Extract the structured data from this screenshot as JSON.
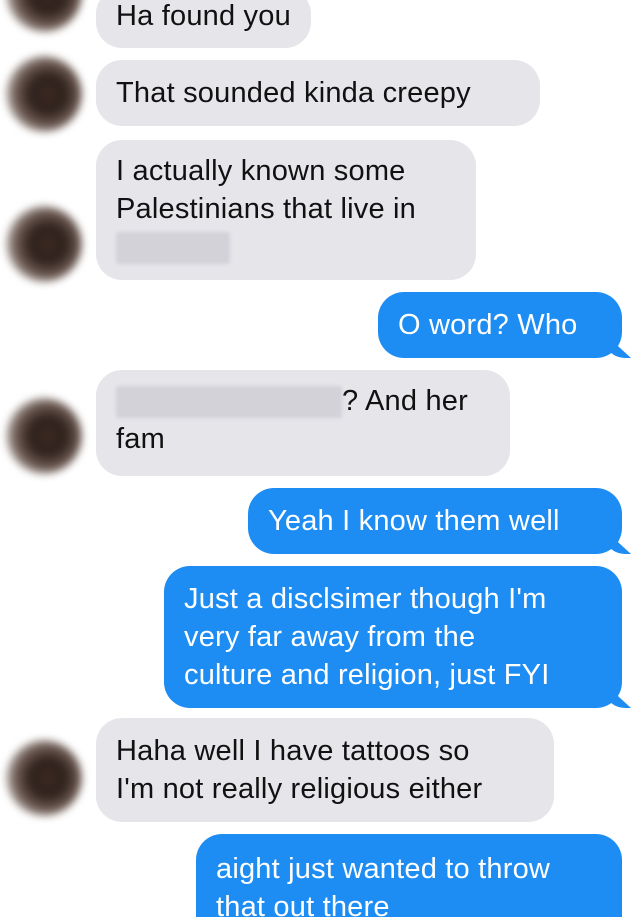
{
  "conversation": {
    "messages": [
      {
        "direction": "incoming",
        "lines": [
          "Ha found you"
        ]
      },
      {
        "direction": "incoming",
        "lines": [
          "That sounded kinda creepy"
        ]
      },
      {
        "direction": "incoming",
        "lines": [
          "I actually known some",
          "Palestinians that live in"
        ],
        "redacted_line": true
      },
      {
        "direction": "outgoing",
        "lines": [
          "O word? Who"
        ]
      },
      {
        "direction": "incoming",
        "lines": [
          "? And her",
          "fam"
        ],
        "redacted_prefix": true
      },
      {
        "direction": "outgoing",
        "lines": [
          "Yeah I know them well"
        ]
      },
      {
        "direction": "outgoing",
        "lines": [
          "Just a disclsimer though I'm",
          "very far away from the",
          "culture and religion, just FYI"
        ]
      },
      {
        "direction": "incoming",
        "lines": [
          "Haha well I have tattoos so",
          "I'm not really religious either"
        ]
      },
      {
        "direction": "outgoing",
        "lines": [
          "aight just wanted to throw",
          "that out there"
        ]
      }
    ]
  }
}
